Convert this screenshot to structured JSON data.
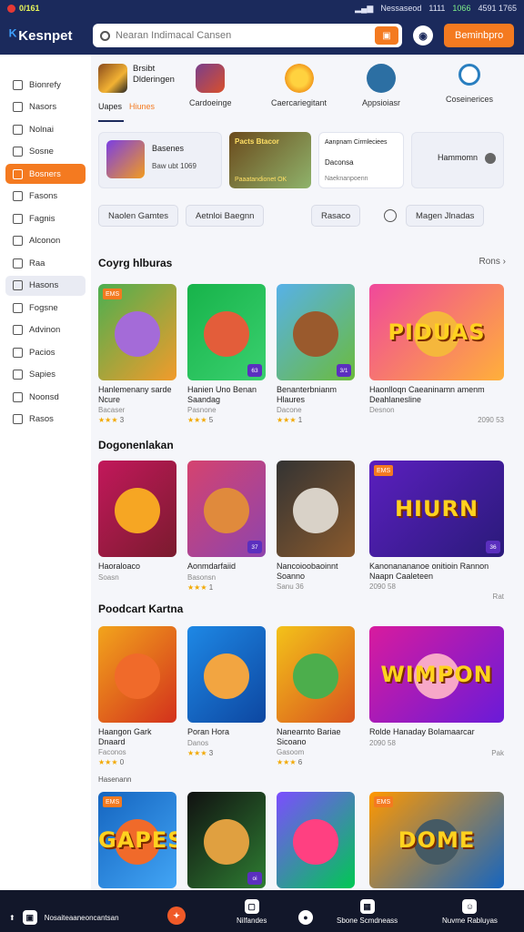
{
  "status_bar": {
    "left_text": "0/161",
    "right_items": [
      "Nessaseod",
      "1111",
      "1066",
      "4591  1765"
    ]
  },
  "header": {
    "logo": "Kesnpet",
    "search_placeholder": "Nearan Indimacal Cansen",
    "action_button": "Beminbpro"
  },
  "sidebar": {
    "items": [
      {
        "label": "Bionrefy",
        "state": "normal"
      },
      {
        "label": "Nasors",
        "state": "normal"
      },
      {
        "label": "Nolnai",
        "state": "normal"
      },
      {
        "label": "Sosne",
        "state": "normal"
      },
      {
        "label": "Bosners",
        "state": "active"
      },
      {
        "label": "Fasons",
        "state": "normal"
      },
      {
        "label": "Fagnis",
        "state": "normal"
      },
      {
        "label": "Alconon",
        "state": "normal"
      },
      {
        "label": "Raa",
        "state": "normal"
      },
      {
        "label": "Hasons",
        "state": "hover"
      },
      {
        "label": "Fogsne",
        "state": "normal"
      },
      {
        "label": "Advinon",
        "state": "normal"
      },
      {
        "label": "Pacios",
        "state": "normal"
      },
      {
        "label": "Sapies",
        "state": "normal"
      },
      {
        "label": "Noonsd",
        "state": "normal"
      },
      {
        "label": "Rasos",
        "state": "normal"
      }
    ]
  },
  "categories": {
    "first": {
      "title_line1": "Brsibt",
      "title_line2": "Dlderingen",
      "tab1": "Uapes",
      "tab2": "Hiunes"
    },
    "items": [
      {
        "label": "Cardoeinge"
      },
      {
        "label": "Caercariegitant"
      },
      {
        "label": "Appsioiasr"
      },
      {
        "label": "Coseinerices"
      }
    ]
  },
  "promos": [
    {
      "title": "Basenes",
      "sub": "Baw ubt 1069"
    },
    {
      "title": "Pacts Btacor",
      "sub": "Paaatandionet OK"
    },
    {
      "title": "Aanpnam Cirmleciees",
      "sub": "Daconsa",
      "foot": "Naeknanpoenn"
    },
    {
      "title": "Hammomn"
    }
  ],
  "chips": [
    "Naolen Gamtes",
    "Aetnloi Baegnn",
    "Rasaco",
    "Magen Jlnadas"
  ],
  "sections": [
    {
      "title": "Coyrg hlburas",
      "more": "Rons",
      "cards": [
        {
          "badge": "EMS",
          "title": "Hanlemenany sarde Ncure",
          "sub": "Bacaser",
          "rating": "3",
          "color1": "#4caf50",
          "color2": "#f29b2b",
          "face": "#a46bd8"
        },
        {
          "badge": "",
          "tag": "63",
          "title": "Hanien Uno Benan Saandag",
          "sub": "Pasnone",
          "rating": "5",
          "color1": "#17b34a",
          "color2": "#3ad06f",
          "face": "#e35d3a"
        },
        {
          "badge": "",
          "tag": "3/1",
          "title": "Benanterbnianm Hlaures",
          "sub": "Dacone",
          "rating": "1",
          "color1": "#57b1e8",
          "color2": "#6bbb3c",
          "face": "#9a5a2d"
        },
        {
          "badge": "",
          "wide": true,
          "big": "PIDUAS",
          "title": "Haonlloqn Caeaninamn amenm Deahlanesline",
          "sub": "Desnon",
          "rating": "",
          "extra": "2090 53",
          "color1": "#f0489b",
          "color2": "#ffb03a",
          "face": "#f5b73c"
        }
      ]
    },
    {
      "title": "Dogonenlakan",
      "more": "",
      "cards": [
        {
          "badge": "",
          "title": "Haoraloaco",
          "sub": "Soasn",
          "rating": "",
          "color1": "#c2185b",
          "color2": "#7a1b2e",
          "face": "#f6a623"
        },
        {
          "badge": "",
          "tag": "37",
          "title": "Aonmdarfaiid",
          "sub": "Basonsn",
          "rating": "1",
          "color1": "#d5436f",
          "color2": "#8e44ad",
          "face": "#e08a3c"
        },
        {
          "badge": "",
          "title": "Nancoioobaoinnt Soanno",
          "sub": "Sanu 36",
          "rating": "",
          "color1": "#333333",
          "color2": "#8a5a2d",
          "face": "#d9d2c8"
        },
        {
          "badge": "EMS",
          "wide": true,
          "big": "HIURN",
          "tag": "36",
          "title": "Kanonanananoe onitioin Rannon Naapn Caaleteen",
          "sub": "2090 58",
          "rating": "",
          "extra": "Rat",
          "color1": "#5b1fbf",
          "color2": "#2a1a7a",
          "face": ""
        }
      ]
    },
    {
      "title": "Poodcart Kartna",
      "more": "",
      "cards": [
        {
          "badge": "",
          "title": "Haangon Gark Dnaard",
          "sub": "Faconos",
          "rating": "0",
          "color1": "#f2a41c",
          "color2": "#d3311c",
          "face": "#f06a2a"
        },
        {
          "badge": "",
          "title": "Poran Hora",
          "sub": "Danos",
          "rating": "3",
          "color1": "#1e88e5",
          "color2": "#0d47a1",
          "face": "#f2a541"
        },
        {
          "badge": "",
          "title": "Nanearnto Bariae Sicoano",
          "sub": "Gasoom",
          "rating": "6",
          "color1": "#f3c21a",
          "color2": "#d9531e",
          "face": "#4cae4c"
        },
        {
          "badge": "",
          "wide": true,
          "big": "WIMPON",
          "title": "Rolde Hanaday Bolamaarcar",
          "sub": "2090 58",
          "rating": "",
          "extra": "Pak",
          "color1": "#d81b9e",
          "color2": "#6a1bd8",
          "face": "#f7a8c8"
        }
      ]
    },
    {
      "title": "Hasenann",
      "more": "",
      "cards": [
        {
          "badge": "EMS",
          "big": "GAPES",
          "title": "",
          "sub": "",
          "rating": "",
          "color1": "#1565c0",
          "color2": "#42a5f5",
          "face": "#f06a2a"
        },
        {
          "badge": "",
          "big": "",
          "tag": "oi",
          "title": "",
          "sub": "",
          "rating": "",
          "color1": "#111111",
          "color2": "#2e7d32",
          "face": "#e0a040"
        },
        {
          "badge": "",
          "title": "",
          "sub": "",
          "rating": "",
          "color1": "#7c4dff",
          "color2": "#00c853",
          "face": "#ff4081"
        },
        {
          "badge": "EMS",
          "wide": true,
          "big": "DOME",
          "title": "",
          "sub": "",
          "rating": "",
          "color1": "#ff9800",
          "color2": "#1565c0",
          "face": "#455a64"
        }
      ]
    }
  ],
  "bottom_nav": [
    {
      "label": "Nosaiteaaneoncantsan"
    },
    {
      "label": ""
    },
    {
      "label": "Nilfandes"
    },
    {
      "label": ""
    },
    {
      "label": "Sbone Scmdneass"
    },
    {
      "label": "Nuvme Rabluyas"
    }
  ],
  "colors": {
    "accent": "#f47a20",
    "navy": "#1b2a5c",
    "bottom_bar": "#12172a"
  }
}
